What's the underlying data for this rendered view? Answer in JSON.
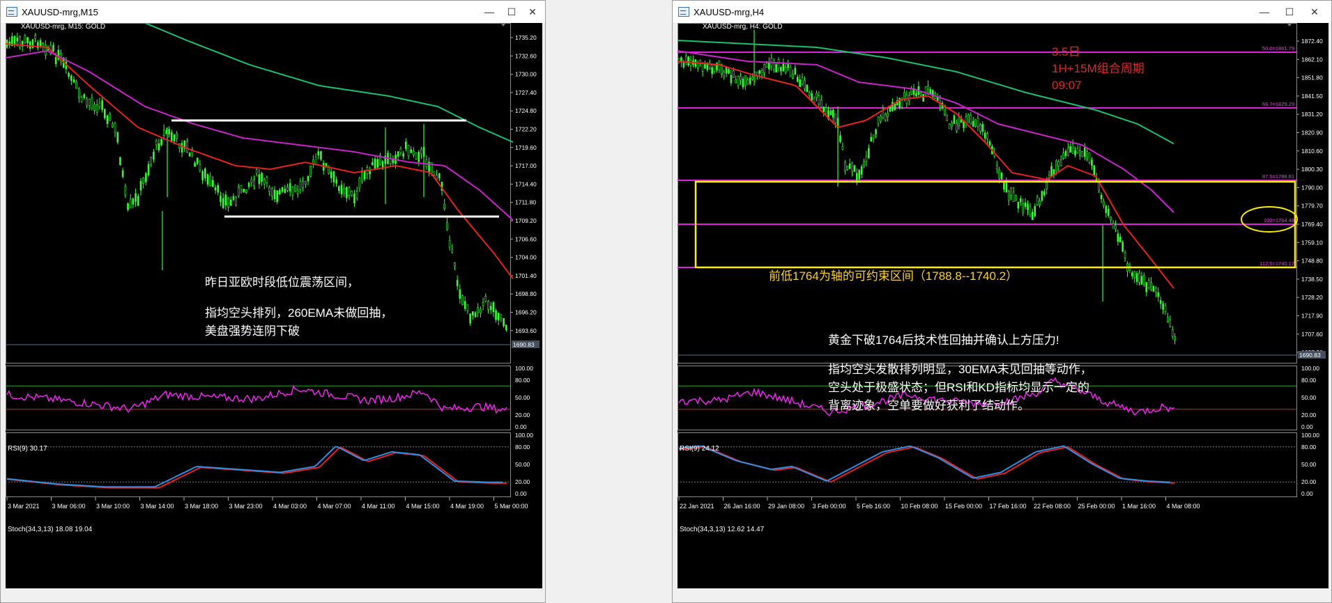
{
  "windows": [
    {
      "title": "XAUUSD-mrg,M15",
      "symbol_label": "XAUUSD-mrg, M15:  GOLD",
      "price_ticks": [
        "1735.20",
        "1732.60",
        "1730.00",
        "1727.40",
        "1724.80",
        "1722.20",
        "1719.60",
        "1717.00",
        "1714.40",
        "1711.80",
        "1709.20",
        "1706.60",
        "1704.00",
        "1701.40",
        "1698.80",
        "1696.20",
        "1693.60"
      ],
      "current_price": "1690.83",
      "rsi_label": "RSI(9) 30.17",
      "rsi_ticks": [
        "100.00",
        "80.00",
        "50.00",
        "20.00",
        "0.00"
      ],
      "stoch_label": "Stoch(34,3,13) 18.08 19.04",
      "stoch_ticks": [
        "100.00",
        "80.00",
        "50.00",
        "20.00",
        "0.00"
      ],
      "time_ticks": [
        "3 Mar 2021",
        "3 Mar 06:00",
        "3 Mar 10:00",
        "3 Mar 14:00",
        "3 Mar 18:00",
        "3 Mar 23:00",
        "4 Mar 03:00",
        "4 Mar 07:00",
        "4 Mar 11:00",
        "4 Mar 15:00",
        "4 Mar 19:00",
        "5 Mar 00:00"
      ],
      "annotations": [
        "昨日亚欧时段低位震荡区间，",
        "指均空头排列，260EMA未做回抽，",
        "美盘强势连阴下破"
      ]
    },
    {
      "title": "XAUUSD-mrg,H4",
      "symbol_label": "XAUUSD-mrg, H4:  GOLD",
      "price_ticks": [
        "1872.40",
        "1862.10",
        "1851.80",
        "1841.50",
        "1831.20",
        "1820.90",
        "1810.60",
        "1800.30",
        "1790.00",
        "1779.70",
        "1769.40",
        "1759.10",
        "1748.80",
        "1738.50",
        "1728.20",
        "1717.90",
        "1707.60",
        "1697.30"
      ],
      "current_price": "1690.83",
      "fib_labels": [
        "50.0=1861.79",
        "66.7=1829.29",
        "87.5=1788.81",
        "100=1764.48",
        "112.5=1740.17"
      ],
      "rsi_label": "RSI(9) 24.12",
      "rsi_ticks": [
        "100.00",
        "80.00",
        "50.00",
        "20.00",
        "0.00"
      ],
      "stoch_label": "Stoch(34,3,13) 12.62 14.47",
      "stoch_ticks": [
        "100.00",
        "80.00",
        "50.00",
        "20.00",
        "0.00"
      ],
      "time_ticks": [
        "22 Jan 2021",
        "26 Jan 16:00",
        "29 Jan 08:00",
        "3 Feb 00:00",
        "5 Feb 16:00",
        "10 Feb 08:00",
        "15 Feb 00:00",
        "17 Feb 16:00",
        "22 Feb 08:00",
        "25 Feb 00:00",
        "1 Mar 16:00",
        "4 Mar 08:00"
      ],
      "header_note": [
        "3.5日",
        "1H+15M组合周期",
        "09:07"
      ],
      "zone_label": "前低1764为轴的可约束区间（1788.8--1740.2）",
      "annotations": [
        "黄金下破1764后技术性回抽并确认上方压力!",
        "指均空头发散排列明显，30EMA未见回抽等动作，",
        "空头处于极盛状态；但RSI和KD指标均显示一定的",
        "背离迹象，空单要做好获利了结动作。"
      ]
    }
  ],
  "colors": {
    "candle": "#33ff33",
    "ema_fast": "#e8231c",
    "ema_mid": "#cc22cc",
    "ema_slow": "#19c26e",
    "rsi": "#ff22ff",
    "stoch_main": "#e8231c",
    "stoch_signal": "#2e8fe8",
    "zone": "#ffee00",
    "fib": "#dd22dd"
  },
  "icons": [
    "app-icon",
    "minimize-icon",
    "maximize-icon",
    "close-icon"
  ]
}
